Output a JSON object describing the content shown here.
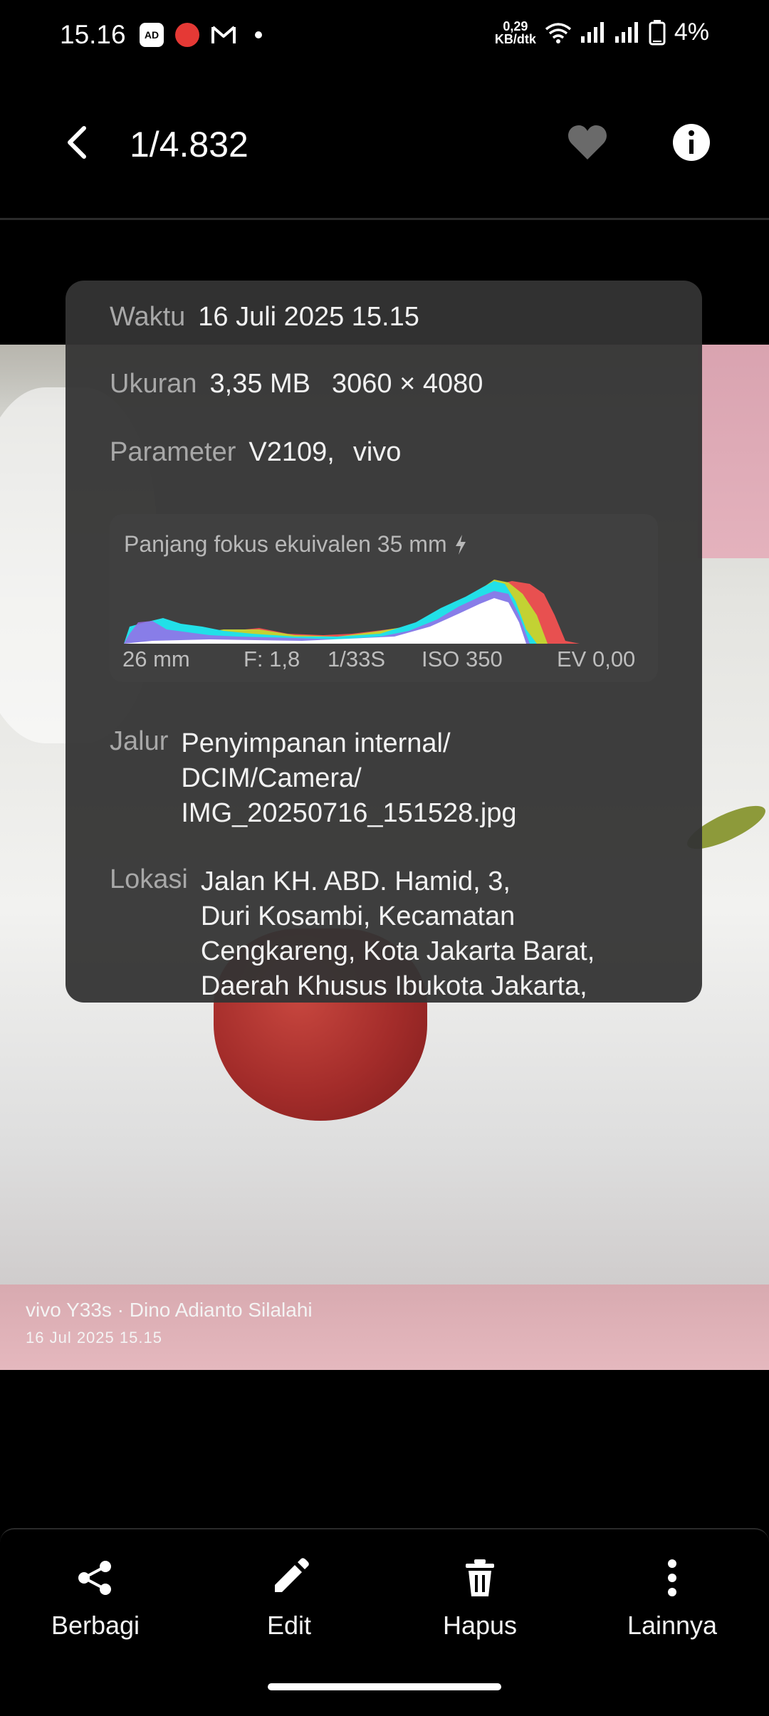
{
  "status_bar": {
    "time": "15.16",
    "ad_label": "AD",
    "net_speed_value": "0,29",
    "net_speed_unit": "KB/dtk",
    "battery": "4%"
  },
  "header": {
    "counter": "1/4.832"
  },
  "info": {
    "waktu_label": "Waktu",
    "waktu_value": "16 Juli 2025 15.15",
    "ukuran_label": "Ukuran",
    "ukuran_size": "3,35 MB",
    "ukuran_dims": "3060 × 4080",
    "parameter_label": "Parameter",
    "parameter_model": "V2109,",
    "parameter_brand": "vivo",
    "histogram": {
      "title": "Panjang fokus ekuivalen 35 mm",
      "focal": "26 mm",
      "aperture": "F: 1,8",
      "shutter": "1/33S",
      "iso": "ISO 350",
      "ev": "EV 0,00"
    },
    "jalur_label": "Jalur",
    "jalur_lines": [
      "Penyimpanan internal/",
      "DCIM/Camera/",
      "IMG_20250716_151528.jpg"
    ],
    "lokasi_label": "Lokasi",
    "lokasi_lines": [
      "Jalan KH. ABD. Hamid, 3,",
      "Duri Kosambi, Kecamatan",
      "Cengkareng, Kota Jakarta Barat,",
      "Daerah Khusus Ibukota Jakarta,"
    ]
  },
  "watermark": {
    "line1": "vivo Y33s · Dino Adianto Silalahi",
    "line2": "16 Jul 2025 15.15"
  },
  "actions": [
    {
      "label": "Berbagi",
      "icon": "share-icon"
    },
    {
      "label": "Edit",
      "icon": "pencil-icon"
    },
    {
      "label": "Hapus",
      "icon": "trash-icon"
    },
    {
      "label": "Lainnya",
      "icon": "more-vertical-icon"
    }
  ],
  "colors": {
    "panel_bg": "#343434",
    "label_gray": "#a8a8a8",
    "background": "#000000"
  }
}
